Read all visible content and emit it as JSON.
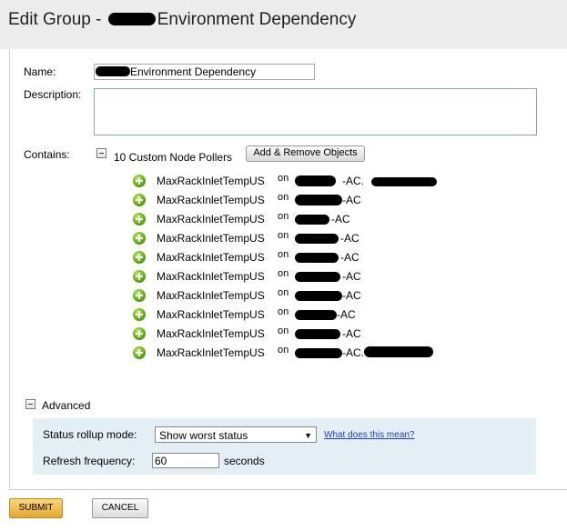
{
  "header": {
    "title_prefix": "Edit Group - ",
    "title_suffix": "Environment Dependency"
  },
  "form": {
    "name_label": "Name:",
    "name_value": "Environment Dependency",
    "description_label": "Description:",
    "description_value": "",
    "contains_label": "Contains:",
    "contains_summary": "10 Custom Node Pollers",
    "add_remove_label": "Add & Remove Objects"
  },
  "pollers": [
    {
      "name": "MaxRackInletTempUS",
      "on": "on",
      "node": "-AC."
    },
    {
      "name": "MaxRackInletTempUS",
      "on": "on",
      "node": "-AC"
    },
    {
      "name": "MaxRackInletTempUS",
      "on": "on",
      "node": "-AC"
    },
    {
      "name": "MaxRackInletTempUS",
      "on": "on",
      "node": "-AC"
    },
    {
      "name": "MaxRackInletTempUS",
      "on": "on",
      "node": "-AC"
    },
    {
      "name": "MaxRackInletTempUS",
      "on": "on",
      "node": "-AC"
    },
    {
      "name": "MaxRackInletTempUS",
      "on": "on",
      "node": "-AC"
    },
    {
      "name": "MaxRackInletTempUS",
      "on": "on",
      "node": "-AC"
    },
    {
      "name": "MaxRackInletTempUS",
      "on": "on",
      "node": "-AC"
    },
    {
      "name": "MaxRackInletTempUS",
      "on": "on",
      "node": "-AC."
    }
  ],
  "advanced": {
    "toggle_label": "Advanced",
    "status_rollup_label": "Status rollup mode:",
    "status_rollup_value": "Show worst status",
    "help_link": "What does this mean?",
    "refresh_label": "Refresh frequency:",
    "refresh_value": "60",
    "refresh_unit": "seconds"
  },
  "actions": {
    "submit_label": "SUBMIT",
    "cancel_label": "CANCEL"
  },
  "icons": {
    "poller": "custom-node-poller-icon",
    "collapse": "minus-toggle-icon",
    "dropdown": "dropdown-arrow-icon"
  },
  "colors": {
    "header_bg": "#ececec",
    "advanced_bg": "#e4eef5",
    "submit_bg": "#f0bd4e",
    "link": "#1a3dc1"
  }
}
